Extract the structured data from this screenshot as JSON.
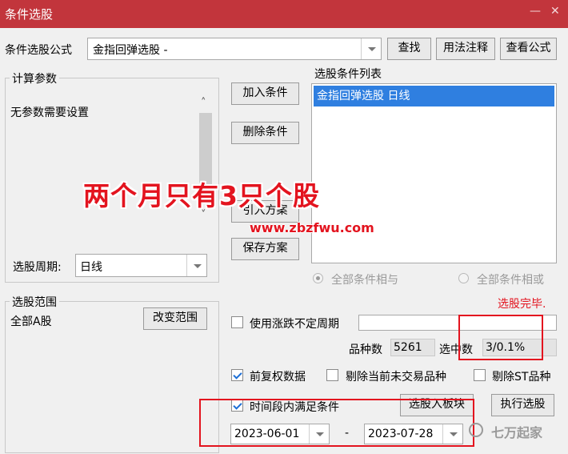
{
  "window": {
    "title": "条件选股"
  },
  "formula": {
    "label": "条件选股公式",
    "value": "金指回弹选股  -"
  },
  "buttons": {
    "find": "查找",
    "usage": "用法注释",
    "view": "查看公式",
    "add": "加入条件",
    "delete": "删除条件",
    "import": "引入方案",
    "save": "保存方案",
    "change_range": "改变范围",
    "to_block": "选股入板块",
    "execute": "执行选股"
  },
  "params": {
    "legend": "计算参数",
    "text": "无参数需要设置",
    "period_label": "选股周期:",
    "period_value": "日线"
  },
  "conditions": {
    "legend": "选股条件列表",
    "items": [
      "金指回弹选股  日线"
    ]
  },
  "logic": {
    "and": "全部条件相与",
    "or": "全部条件相或"
  },
  "range": {
    "legend": "选股范围",
    "value": "全部A股"
  },
  "status": {
    "done": "选股完毕."
  },
  "options": {
    "indefinite": "使用涨跌不定周期",
    "fq": "前复权数据",
    "exclude_untraded": "剔除当前未交易品种",
    "exclude_st": "剔除ST品种",
    "time_period": "时间段内满足条件"
  },
  "stats": {
    "count_label": "品种数",
    "count_value": "5261",
    "selected_label": "选中数",
    "selected_value": "3/0.1%"
  },
  "dates": {
    "start": "2023-06-01",
    "sep": "-",
    "end": "2023-07-28"
  },
  "overlay": {
    "text": "两个月只有3只个股",
    "url": "www.zbzfwu.com",
    "brand": "七万起家"
  },
  "colors": {
    "titlebar": "#c2353c",
    "selection": "#2f7fe0",
    "highlight": "#e3141f"
  }
}
